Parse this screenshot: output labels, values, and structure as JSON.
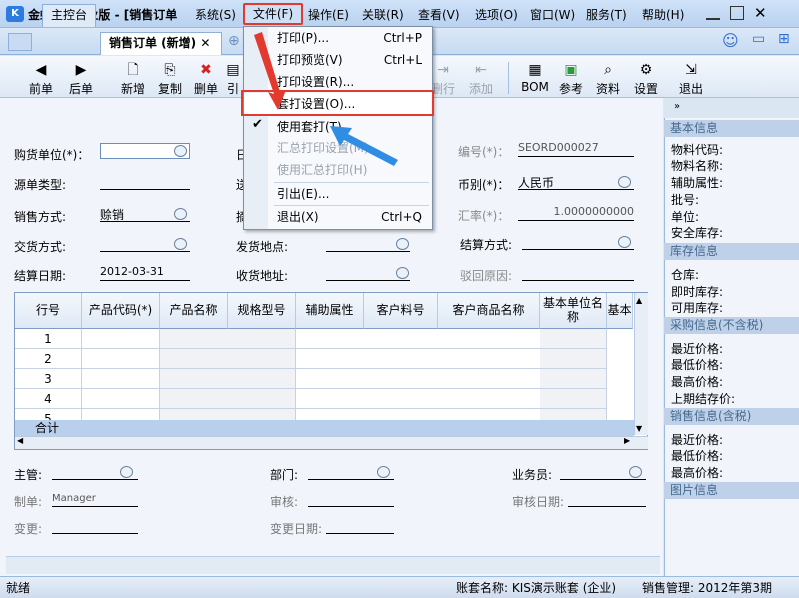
{
  "app": {
    "title": "金蝶KIS专业版 - [销售订单",
    "icon": "K"
  },
  "menu": [
    "系统(S)",
    "文件(F)",
    "操作(E)",
    "关联(R)",
    "查看(V)",
    "选项(O)",
    "窗口(W)",
    "服务(T)",
    "帮助(H)"
  ],
  "tabs": [
    "主控台",
    "销售订单 (新增)"
  ],
  "toolbar": [
    "前单",
    "后单",
    "新增",
    "复制",
    "删单",
    "引",
    "删行",
    "添加",
    "BOM",
    "参考",
    "资料",
    "设置",
    "退出"
  ],
  "form": {
    "buyer": "购货单位(*)：",
    "source": "源单类型:",
    "sale_method": "销售方式:",
    "sale_method_val": "赊销",
    "delivery_method": "交货方式:",
    "settle_date": "结算日期:",
    "settle_date_val": "2012-03-31",
    "delivery_place": "发货地点:",
    "receive_addr": "收货地址:",
    "bill_no": "编号(*)：",
    "bill_no_val": "SEORD000027",
    "currency": "币别(*)：",
    "currency_val": "人民币",
    "rate": "汇率(*)：",
    "rate_val": "1.0000000000",
    "settle_method": "结算方式:",
    "reject": "驳回原因:",
    "d1": "日",
    "d2": "送",
    "d3": "摘"
  },
  "grid": {
    "headers": [
      "行号",
      "产品代码(*)",
      "产品名称",
      "规格型号",
      "辅助属性",
      "客户料号",
      "客户商品名称",
      "基本单位名称",
      "基本"
    ],
    "rows": [
      "1",
      "2",
      "3",
      "4",
      "5"
    ],
    "total": "合计"
  },
  "footer": {
    "manager": "主管:",
    "dept": "部门:",
    "clerk": "业务员:",
    "maker": "制单:",
    "maker_val": "Manager",
    "audit": "审核:",
    "audit_date": "审核日期:",
    "change": "变更:",
    "change_date": "变更日期:"
  },
  "side": {
    "sections": [
      "基本信息",
      "库存信息",
      "采购信息(不含税)",
      "销售信息(含税)",
      "图片信息"
    ],
    "basic": [
      "物料代码:",
      "物料名称:",
      "辅助属性:",
      "批号:",
      "单位:",
      "安全库存:"
    ],
    "stock": [
      "仓库:",
      "即时库存:",
      "可用库存:"
    ],
    "purchase": [
      "最近价格:",
      "最低价格:",
      "最高价格:",
      "上期结存价:"
    ],
    "sales": [
      "最近价格:",
      "最低价格:",
      "最高价格:"
    ]
  },
  "status": {
    "left": "就绪",
    "account": "账套名称: KIS演示账套 (企业)",
    "period": "销售管理: 2012年第3期"
  },
  "dropdown": [
    {
      "label": "打印(P)...",
      "sc": "Ctrl+P"
    },
    {
      "label": "打印预览(V)",
      "sc": "Ctrl+L"
    },
    {
      "label": "打印设置(R)...",
      "sc": ""
    },
    {
      "label": "套打设置(O)...",
      "sc": ""
    },
    {
      "label": "使用套打(T)",
      "sc": ""
    },
    {
      "label": "汇总打印设置(M)...",
      "sc": ""
    },
    {
      "label": "使用汇总打印(H)",
      "sc": ""
    },
    {
      "label": "引出(E)...",
      "sc": ""
    },
    {
      "label": "退出(X)",
      "sc": "Ctrl+Q"
    }
  ],
  "colors": {
    "highlight": "#e23a2e",
    "arrow_red": "#e23a2e",
    "arrow_blue": "#2f8de4"
  }
}
